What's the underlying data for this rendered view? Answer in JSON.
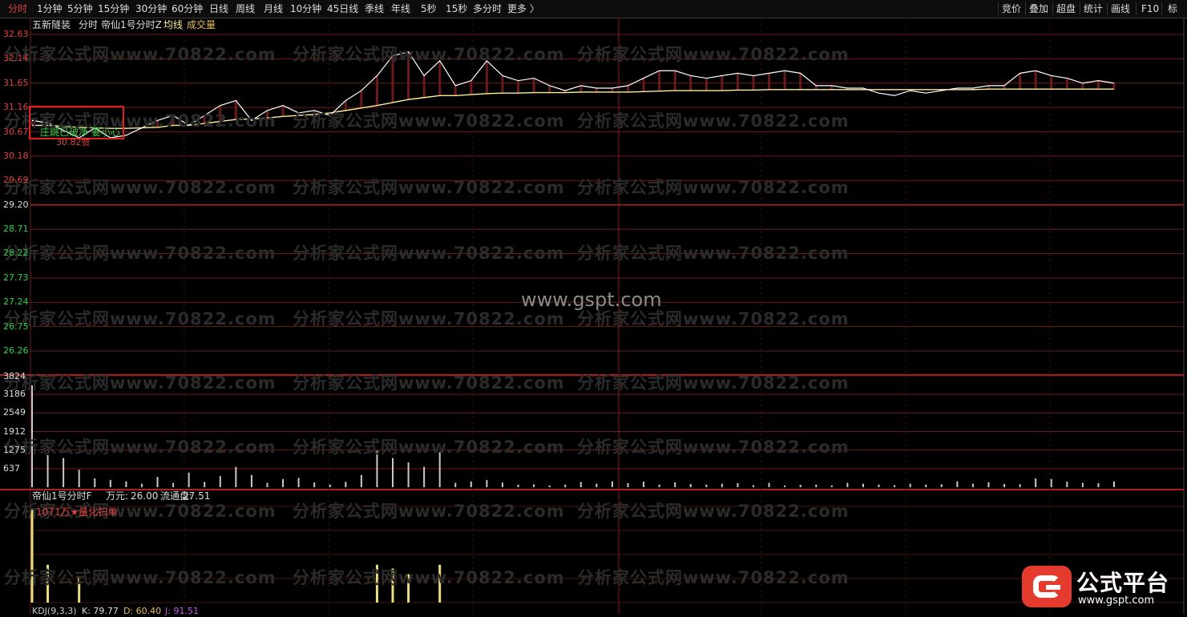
{
  "toolbar": {
    "tabs": [
      "分时",
      "1分钟",
      "5分钟",
      "15分钟",
      "30分钟",
      "60分钟",
      "日线",
      "周线",
      "月线",
      "10分钟",
      "45日线",
      "季线",
      "年线",
      "5秒",
      "15秒",
      "多分时",
      "更多 〉"
    ],
    "active": "分时",
    "right_buttons": [
      "竞价",
      "叠加",
      "超盘",
      "统计",
      "画线",
      "F10",
      "标 "
    ]
  },
  "main_header": {
    "stock": "五新隧装",
    "mode": "分时",
    "indicator": "帝仙1号分时Z",
    "avg_label": "均线",
    "vol_label": "成交量"
  },
  "price_axis": [
    "32.63",
    "32.14",
    "31.65",
    "31.16",
    "30.67",
    "30.18",
    "29.69",
    "29.20",
    "28.71",
    "28.22",
    "27.73",
    "27.24",
    "26.75",
    "26.26"
  ],
  "volume_axis": [
    "3824",
    "3186",
    "2549",
    "1912",
    "1275",
    "637"
  ],
  "alert": {
    "text": "庄跳已破净 要小心",
    "sub": "30.82赞"
  },
  "sub_header": {
    "name": "帝仙1号分时F",
    "wan_label": "万元:",
    "wan_value": "26.00",
    "float_label": "流通盘:",
    "float_value": "27.51"
  },
  "sub_note": "1071万★量化扫单",
  "kdj": {
    "label": "KDJ(9,3,3)",
    "k": "K: 79.77",
    "d": "D: 60.40",
    "j": "J: 91.51"
  },
  "watermark": {
    "text": "分析家公式网www.70822.com",
    "center": "www.gspt.com"
  },
  "logo": {
    "name": "公式平台",
    "url": "www.gspt.com"
  },
  "colors": {
    "up": "#e04040",
    "down": "#2fd24a",
    "grid": "#6e1a1a",
    "price_line": "#ffffff",
    "avg_line": "#ffef9a",
    "vol_bar": "#c9c9c9",
    "sub_bar": "#ecdd80"
  },
  "chart_data": {
    "type": "line",
    "price_series": [
      30.9,
      30.85,
      30.7,
      30.55,
      30.75,
      30.55,
      30.6,
      30.75,
      30.9,
      31.0,
      30.8,
      31.0,
      31.2,
      31.3,
      30.9,
      31.1,
      31.2,
      31.05,
      31.1,
      31.0,
      31.3,
      31.5,
      31.8,
      32.2,
      32.28,
      31.8,
      32.1,
      31.6,
      31.7,
      32.1,
      31.8,
      31.7,
      31.75,
      31.6,
      31.5,
      31.6,
      31.55,
      31.55,
      31.6,
      31.75,
      31.9,
      31.9,
      31.8,
      31.75,
      31.8,
      31.85,
      31.8,
      31.85,
      31.9,
      31.85,
      31.6,
      31.6,
      31.55,
      31.55,
      31.45,
      31.4,
      31.5,
      31.45,
      31.5,
      31.55,
      31.55,
      31.6,
      31.6,
      31.85,
      31.9,
      31.8,
      31.75,
      31.65,
      31.7,
      31.65
    ],
    "avg_series": [
      30.8,
      30.8,
      30.78,
      30.76,
      30.75,
      30.74,
      30.74,
      30.75,
      30.76,
      30.8,
      30.8,
      30.84,
      30.88,
      30.92,
      30.93,
      30.95,
      30.98,
      31.0,
      31.02,
      31.05,
      31.1,
      31.15,
      31.2,
      31.26,
      31.32,
      31.36,
      31.4,
      31.4,
      31.42,
      31.44,
      31.45,
      31.45,
      31.46,
      31.46,
      31.46,
      31.47,
      31.47,
      31.47,
      31.47,
      31.48,
      31.49,
      31.5,
      31.5,
      31.5,
      31.5,
      31.51,
      31.51,
      31.52,
      31.52,
      31.52,
      31.52,
      31.52,
      31.52,
      31.52,
      31.52,
      31.52,
      31.52,
      31.52,
      31.52,
      31.52,
      31.52,
      31.53,
      31.53,
      31.53,
      31.53,
      31.53,
      31.53,
      31.53,
      31.53,
      31.53
    ],
    "volume": [
      3500,
      1100,
      1000,
      600,
      300,
      250,
      200,
      120,
      350,
      150,
      500,
      180,
      380,
      700,
      420,
      150,
      280,
      320,
      160,
      90,
      180,
      420,
      1250,
      1000,
      850,
      700,
      1200,
      150,
      200,
      250,
      160,
      90,
      100,
      60,
      90,
      180,
      120,
      200,
      140,
      190,
      90,
      170,
      110,
      90,
      120,
      140,
      70,
      150,
      60,
      80,
      90,
      60,
      150,
      120,
      90,
      70,
      120,
      90,
      100,
      200,
      120,
      170,
      110,
      100,
      300,
      280,
      190,
      150,
      140,
      200
    ],
    "sub_volume": [
      5.0,
      2.0,
      0,
      1.4,
      0,
      0,
      0,
      0,
      0,
      0,
      0,
      0,
      0,
      0,
      0,
      0,
      0,
      0,
      0,
      0,
      0,
      0,
      2.0,
      1.8,
      1.5,
      0,
      2.0,
      0,
      0,
      0,
      0,
      0,
      0,
      0,
      0,
      0,
      0,
      0,
      0,
      0,
      0,
      0,
      0,
      0,
      0,
      0,
      0,
      0,
      0,
      0,
      0,
      0,
      0,
      0,
      0,
      0,
      0,
      0,
      0,
      0,
      0,
      0,
      0,
      0,
      0,
      0,
      0,
      0,
      0,
      0
    ],
    "ylim_price": [
      26.26,
      32.63
    ],
    "ylim_volume": [
      0,
      3824
    ]
  }
}
